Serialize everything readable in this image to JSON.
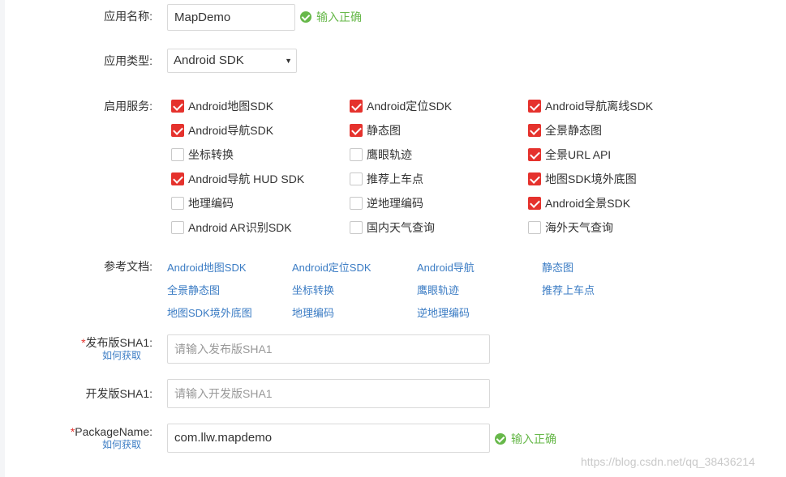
{
  "app_name": {
    "label": "应用名称:",
    "value": "MapDemo",
    "valid_text": "输入正确"
  },
  "app_type": {
    "label": "应用类型:",
    "value": "Android SDK"
  },
  "services": {
    "label": "启用服务:",
    "items": [
      {
        "label": "Android地图SDK",
        "checked": true
      },
      {
        "label": "Android定位SDK",
        "checked": true
      },
      {
        "label": "Android导航离线SDK",
        "checked": true
      },
      {
        "label": "Android导航SDK",
        "checked": true
      },
      {
        "label": "静态图",
        "checked": true
      },
      {
        "label": "全景静态图",
        "checked": true
      },
      {
        "label": "坐标转换",
        "checked": false
      },
      {
        "label": "鹰眼轨迹",
        "checked": false
      },
      {
        "label": "全景URL API",
        "checked": true
      },
      {
        "label": "Android导航 HUD SDK",
        "checked": true
      },
      {
        "label": "推荐上车点",
        "checked": false
      },
      {
        "label": "地图SDK境外底图",
        "checked": true
      },
      {
        "label": "地理编码",
        "checked": false
      },
      {
        "label": "逆地理编码",
        "checked": false
      },
      {
        "label": "Android全景SDK",
        "checked": true
      },
      {
        "label": "Android AR识别SDK",
        "checked": false
      },
      {
        "label": "国内天气查询",
        "checked": false
      },
      {
        "label": "海外天气查询",
        "checked": false
      }
    ]
  },
  "docs": {
    "label": "参考文档:",
    "links": [
      "Android地图SDK",
      "Android定位SDK",
      "Android导航",
      "静态图",
      "全景静态图",
      "坐标转换",
      "鹰眼轨迹",
      "推荐上车点",
      "地图SDK境外底图",
      "地理编码",
      "逆地理编码"
    ]
  },
  "release_sha1": {
    "required_mark": "*",
    "label": "发布版SHA1:",
    "howto": "如何获取",
    "placeholder": "请输入发布版SHA1"
  },
  "dev_sha1": {
    "label": "开发版SHA1:",
    "placeholder": "请输入开发版SHA1"
  },
  "package_name": {
    "required_mark": "*",
    "label": "PackageName:",
    "howto": "如何获取",
    "value": "com.llw.mapdemo",
    "valid_text": "输入正确"
  },
  "watermark": "https://blog.csdn.net/qq_38436214",
  "colors": {
    "checkbox_checked": "#e5322d",
    "valid_green": "#67b84a",
    "link_blue": "#3b7cc4"
  }
}
